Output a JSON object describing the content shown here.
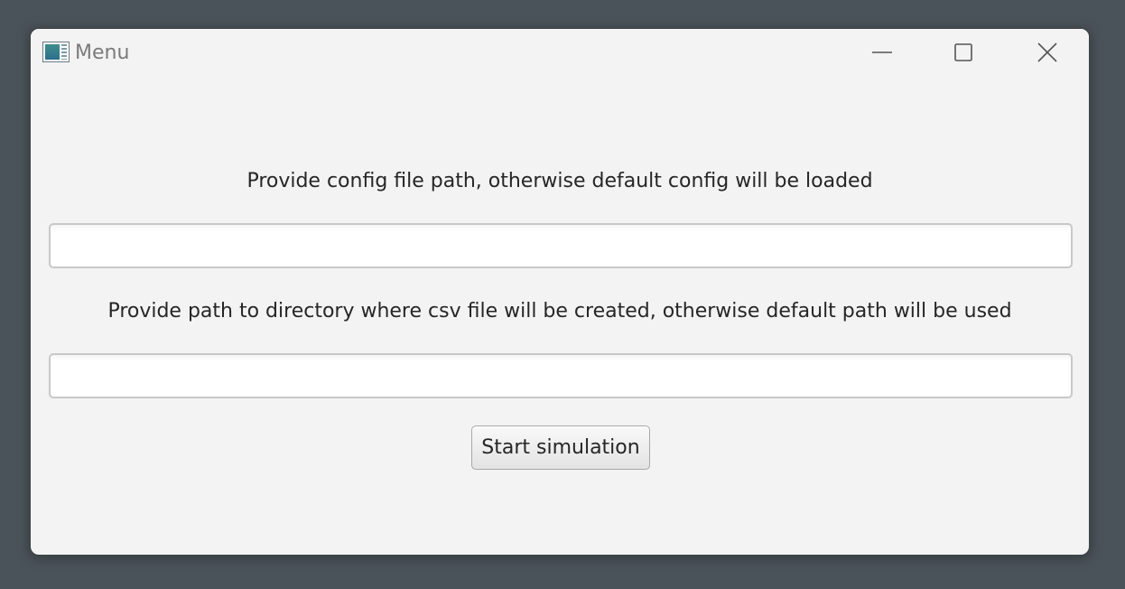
{
  "window": {
    "title": "Menu",
    "app_icon": "app-window-icon",
    "controls": {
      "minimize_icon": "minimize-icon",
      "maximize_icon": "maximize-icon",
      "close_icon": "close-icon"
    }
  },
  "form": {
    "config_prompt": "Provide config file path, otherwise default config will be loaded",
    "config_value": "",
    "config_placeholder": "",
    "csv_prompt": "Provide path to directory where csv file will be created, otherwise default path will be used",
    "csv_value": "",
    "csv_placeholder": "",
    "start_label": "Start simulation"
  },
  "colors": {
    "desktop_background": "#4a5359",
    "window_background": "#f3f3f3",
    "text": "#262626",
    "title_text": "#7a7a7a"
  }
}
